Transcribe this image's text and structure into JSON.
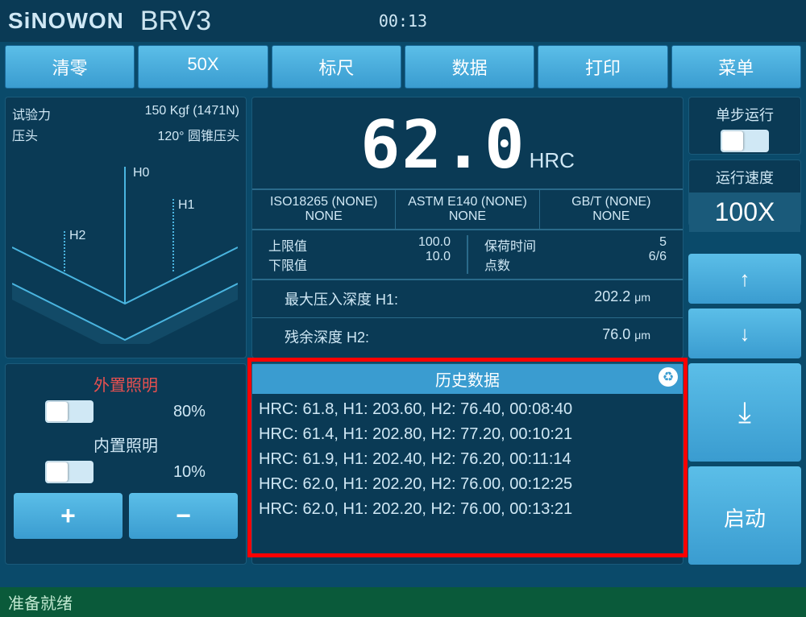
{
  "header": {
    "logo": "SiNOWON",
    "model": "BRV3",
    "clock": "00:13"
  },
  "menu": {
    "b0": "清零",
    "b1": "50X",
    "b2": "标尺",
    "b3": "数据",
    "b4": "打印",
    "b5": "菜单"
  },
  "left": {
    "force_label": "试验力",
    "force_value": "150 Kgf (1471N)",
    "indenter_label": "压头",
    "indenter_value": "120° 圆锥压头",
    "diagram": {
      "h0": "H0",
      "h1": "H1",
      "h2": "H2"
    }
  },
  "main": {
    "reading": "62.0",
    "unit": "HRC",
    "std": {
      "iso_label": "ISO18265 (NONE)",
      "iso_val": "NONE",
      "astm_label": "ASTM E140 (NONE)",
      "astm_val": "NONE",
      "gbt_label": "GB/T (NONE)",
      "gbt_val": "NONE"
    },
    "limits": {
      "upper_label": "上限值",
      "upper_val": "100.0",
      "lower_label": "下限值",
      "lower_val": "10.0",
      "dwell_label": "保荷时间",
      "dwell_val": "5",
      "points_label": "点数",
      "points_val": "6/6"
    },
    "depth": {
      "h1_label": "最大压入深度 H1:",
      "h1_val": "202.2",
      "h1_unit": "μm",
      "h2_label": "残余深度 H2:",
      "h2_val": "76.0",
      "h2_unit": "μm"
    }
  },
  "right": {
    "step_label": "单步运行",
    "speed_label": "运行速度",
    "speed_val": "100X"
  },
  "light": {
    "ext_label": "外置照明",
    "ext_val": "80%",
    "int_label": "内置照明",
    "int_val": "10%"
  },
  "history": {
    "title": "历史数据",
    "rows": [
      "HRC: 61.8, H1: 203.60, H2: 76.40, 00:08:40",
      "HRC: 61.4, H1: 202.80, H2: 77.20, 00:10:21",
      "HRC: 61.9, H1: 202.40, H2: 76.20, 00:11:14",
      "HRC: 62.0, H1: 202.20, H2: 76.00, 00:12:25",
      "HRC: 62.0, H1: 202.20, H2: 76.00, 00:13:21"
    ]
  },
  "start": "启动",
  "status": "准备就绪"
}
